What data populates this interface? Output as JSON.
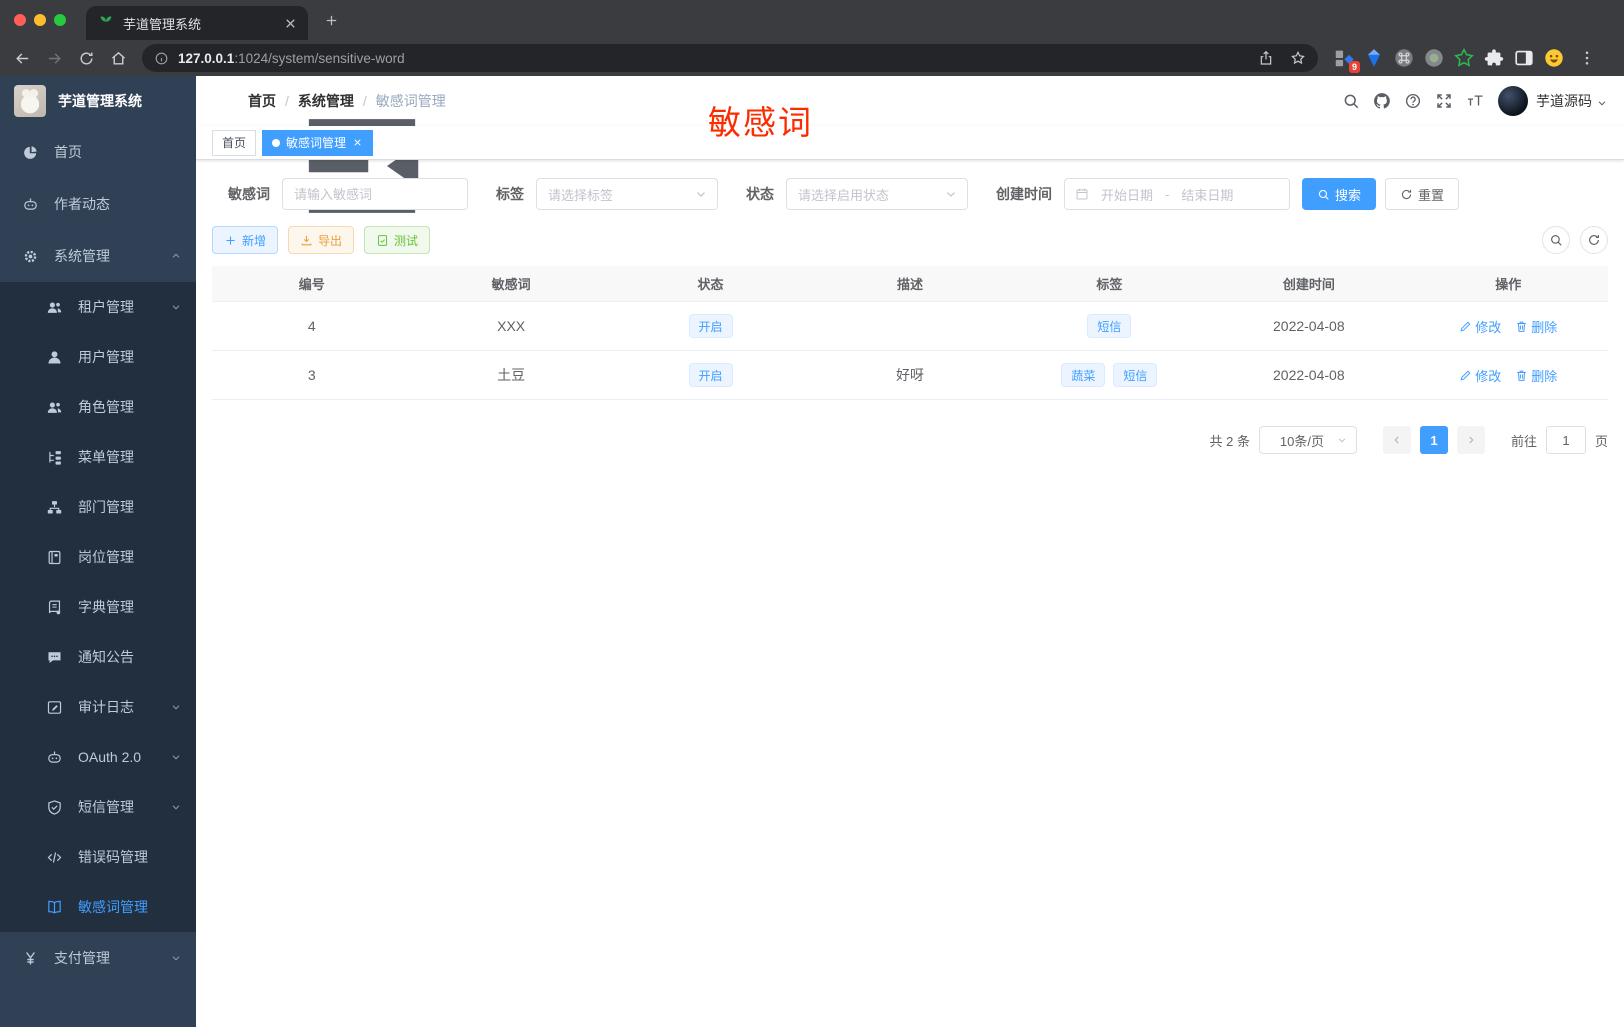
{
  "browser": {
    "tab_title": "芋道管理系统",
    "favicon": "plant-icon",
    "url_host": "127.0.0.1",
    "url_path": ":1024/system/sensitive-word",
    "extensions_badge": "9",
    "extensions": [
      "tab-grid-icon",
      "gem-icon",
      "command-icon",
      "record-icon",
      "green-star-icon",
      "puzzle-icon",
      "split-view-icon",
      "emoji-icon"
    ]
  },
  "sidebar": {
    "title": "芋道管理系统",
    "items": [
      {
        "icon": "dashboard-icon",
        "sym": "gauge",
        "label": "首页",
        "level": "top"
      },
      {
        "icon": "author-news-icon",
        "sym": "robot",
        "label": "作者动态",
        "level": "top"
      },
      {
        "icon": "gear-icon",
        "sym": "gear",
        "label": "系统管理",
        "level": "top",
        "chevron": "up"
      },
      {
        "icon": "tenant-icon",
        "sym": "users",
        "label": "租户管理",
        "level": "sub",
        "chevron": "down"
      },
      {
        "icon": "user-icon",
        "sym": "user",
        "label": "用户管理",
        "level": "sub"
      },
      {
        "icon": "role-icon",
        "sym": "users",
        "label": "角色管理",
        "level": "sub"
      },
      {
        "icon": "menu-tree-icon",
        "sym": "tree",
        "label": "菜单管理",
        "level": "sub"
      },
      {
        "icon": "department-icon",
        "sym": "org",
        "label": "部门管理",
        "level": "sub"
      },
      {
        "icon": "post-icon",
        "sym": "badge",
        "label": "岗位管理",
        "level": "sub"
      },
      {
        "icon": "dictionary-icon",
        "sym": "book",
        "label": "字典管理",
        "level": "sub"
      },
      {
        "icon": "notice-icon",
        "sym": "comment",
        "label": "通知公告",
        "level": "sub"
      },
      {
        "icon": "audit-log-icon",
        "sym": "log",
        "label": "审计日志",
        "level": "sub",
        "chevron": "down"
      },
      {
        "icon": "oauth-icon",
        "sym": "robot",
        "label": "OAuth 2.0",
        "level": "sub",
        "chevron": "down"
      },
      {
        "icon": "sms-icon",
        "sym": "shield",
        "label": "短信管理",
        "level": "sub",
        "chevron": "down"
      },
      {
        "icon": "error-code-icon",
        "sym": "code",
        "label": "错误码管理",
        "level": "sub"
      },
      {
        "icon": "sensitive-word-icon",
        "sym": "book-open",
        "label": "敏感词管理",
        "level": "sub",
        "active": true
      },
      {
        "icon": "pay-icon",
        "sym": "yen",
        "label": "支付管理",
        "level": "top",
        "chevron": "down"
      }
    ]
  },
  "navbar": {
    "breadcrumb": [
      "首页",
      "系统管理",
      "敏感词管理"
    ],
    "icons": [
      {
        "name": "search-icon",
        "sym": "search"
      },
      {
        "name": "github-icon",
        "sym": "github"
      },
      {
        "name": "help-icon",
        "sym": "question"
      },
      {
        "name": "fullscreen-icon",
        "sym": "fullscreen"
      },
      {
        "name": "font-size-icon",
        "sym": "font-size"
      }
    ],
    "username": "芋道源码"
  },
  "watermark": "敏感词",
  "tags_view": [
    {
      "label": "首页",
      "active": false
    },
    {
      "label": "敏感词管理",
      "active": true
    }
  ],
  "filters": {
    "word": {
      "label": "敏感词",
      "placeholder": "请输入敏感词"
    },
    "tag": {
      "label": "标签",
      "placeholder": "请选择标签"
    },
    "status": {
      "label": "状态",
      "placeholder": "请选择启用状态"
    },
    "created": {
      "label": "创建时间",
      "start": "开始日期",
      "separator": "-",
      "end": "结束日期"
    },
    "search_label": "搜索",
    "reset_label": "重置"
  },
  "toolbar": {
    "add_label": "新增",
    "export_label": "导出",
    "test_label": "测试"
  },
  "table": {
    "columns": [
      "编号",
      "敏感词",
      "状态",
      "描述",
      "标签",
      "创建时间",
      "操作"
    ],
    "rows": [
      {
        "id": "4",
        "word": "XXX",
        "status": "开启",
        "description": "",
        "tags": [
          "短信"
        ],
        "created": "2022-04-08"
      },
      {
        "id": "3",
        "word": "土豆",
        "status": "开启",
        "description": "好呀",
        "tags": [
          "蔬菜",
          "短信"
        ],
        "created": "2022-04-08"
      }
    ],
    "edit_label": "修改",
    "delete_label": "删除"
  },
  "pagination": {
    "total": "共 2 条",
    "page_size": "10条/页",
    "current_page": "1",
    "goto_label": "前往",
    "goto_value": "1",
    "page_unit": "页"
  },
  "colors": {
    "primary": "#409eff",
    "watermark_red": "#fb2c00",
    "sidebar_bg": "#304156",
    "submenu_bg": "#212f3f",
    "export_orange": "#e6a23c",
    "test_green": "#67c23a"
  }
}
